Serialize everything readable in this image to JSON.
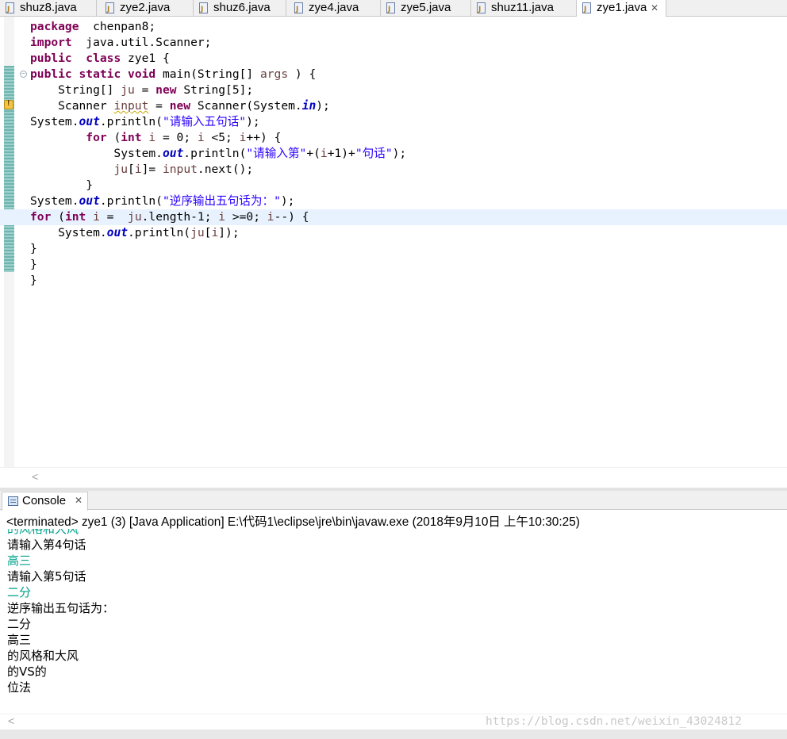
{
  "tabs": [
    {
      "label": "shuz8.java",
      "active": false
    },
    {
      "label": "zye2.java",
      "active": false
    },
    {
      "label": "shuz6.java",
      "active": false
    },
    {
      "label": "zye4.java",
      "active": false
    },
    {
      "label": "zye5.java",
      "active": false
    },
    {
      "label": "shuz11.java",
      "active": false
    },
    {
      "label": "zye1.java",
      "active": true,
      "close": "✕"
    }
  ],
  "code_lines": [
    [
      [
        "kw",
        "package"
      ],
      [
        "",
        "  chenpan8;"
      ]
    ],
    [
      [
        "kw",
        "import"
      ],
      [
        "",
        "  java.util.Scanner;"
      ]
    ],
    [
      [
        "kw",
        "public"
      ],
      [
        "",
        "  "
      ],
      [
        "kw",
        "class"
      ],
      [
        "",
        " zye1 {"
      ]
    ],
    [
      [
        "kw",
        "public"
      ],
      [
        "",
        " "
      ],
      [
        "kw",
        "static"
      ],
      [
        "",
        " "
      ],
      [
        "kw",
        "void"
      ],
      [
        "",
        " main(String[] "
      ],
      [
        "var",
        "args"
      ],
      [
        "",
        " ) {"
      ]
    ],
    [
      [
        "",
        "    String[] "
      ],
      [
        "var",
        "ju"
      ],
      [
        "",
        " = "
      ],
      [
        "kw",
        "new"
      ],
      [
        "",
        " String[5];"
      ]
    ],
    [
      [
        "",
        "    Scanner "
      ],
      [
        "var ul",
        "input"
      ],
      [
        "",
        " = "
      ],
      [
        "kw",
        "new"
      ],
      [
        "",
        " Scanner(System."
      ],
      [
        "fld",
        "in"
      ],
      [
        "",
        ");"
      ]
    ],
    [
      [
        "",
        "System."
      ],
      [
        "fld",
        "out"
      ],
      [
        "",
        ".println("
      ],
      [
        "str",
        "\"请输入五句话\""
      ],
      [
        "",
        ");"
      ]
    ],
    [
      [
        "",
        "        "
      ],
      [
        "kw",
        "for"
      ],
      [
        "",
        " ("
      ],
      [
        "kw",
        "int"
      ],
      [
        "",
        " "
      ],
      [
        "var",
        "i"
      ],
      [
        "",
        " = 0; "
      ],
      [
        "var",
        "i"
      ],
      [
        "",
        " <5; "
      ],
      [
        "var",
        "i"
      ],
      [
        "",
        "++) {"
      ]
    ],
    [
      [
        "",
        "            System."
      ],
      [
        "fld",
        "out"
      ],
      [
        "",
        ".println("
      ],
      [
        "str",
        "\"请输入第\""
      ],
      [
        "",
        "+("
      ],
      [
        "var",
        "i"
      ],
      [
        "",
        "+1)+"
      ],
      [
        "str",
        "\"句话\""
      ],
      [
        "",
        ");"
      ]
    ],
    [
      [
        "",
        "            "
      ],
      [
        "var",
        "ju"
      ],
      [
        "",
        "["
      ],
      [
        "var",
        "i"
      ],
      [
        "",
        "]= "
      ],
      [
        "var",
        "input"
      ],
      [
        "",
        ".next();"
      ]
    ],
    [
      [
        "",
        "        }"
      ]
    ],
    [
      [
        "",
        "System."
      ],
      [
        "fld",
        "out"
      ],
      [
        "",
        ".println("
      ],
      [
        "str",
        "\"逆序输出五句话为：\""
      ],
      [
        "",
        ");"
      ]
    ],
    [
      [
        "kw",
        "for"
      ],
      [
        "",
        " ("
      ],
      [
        "kw",
        "int"
      ],
      [
        "",
        " "
      ],
      [
        "var",
        "i"
      ],
      [
        "",
        " =  "
      ],
      [
        "var",
        "ju"
      ],
      [
        "",
        ".length-1; "
      ],
      [
        "var",
        "i"
      ],
      [
        "",
        " >=0; "
      ],
      [
        "var",
        "i"
      ],
      [
        "",
        "--) {"
      ]
    ],
    [
      [
        "",
        "    System."
      ],
      [
        "fld",
        "out"
      ],
      [
        "",
        ".println("
      ],
      [
        "var",
        "ju"
      ],
      [
        "",
        "["
      ],
      [
        "var",
        "i"
      ],
      [
        "",
        "]);"
      ]
    ],
    [
      [
        "",
        "}"
      ]
    ],
    [
      [
        "",
        "}"
      ]
    ],
    [
      [
        "",
        "}"
      ]
    ]
  ],
  "highlight_line": 12,
  "console": {
    "tab_label": "Console",
    "tab_close": "✕",
    "status_line": "<terminated> zye1 (3) [Java Application] E:\\代码1\\eclipse\\jre\\bin\\javaw.exe (2018年9月10日 上午10:30:25)",
    "output": [
      {
        "text": "的风格和大风",
        "input": true
      },
      {
        "text": "请输入第4句话",
        "input": false
      },
      {
        "text": "高三",
        "input": true
      },
      {
        "text": "请输入第5句话",
        "input": false
      },
      {
        "text": "二分",
        "input": true
      },
      {
        "text": "逆序输出五句话为：",
        "input": false
      },
      {
        "text": "二分",
        "input": false
      },
      {
        "text": "高三",
        "input": false
      },
      {
        "text": "的风格和大风",
        "input": false
      },
      {
        "text": "的VS的",
        "input": false
      },
      {
        "text": "位法",
        "input": false
      }
    ]
  },
  "scroll_arrow_left": "<",
  "watermark": "https://blog.csdn.net/weixin_43024812",
  "colors": {
    "keyword": "#7f0055",
    "field": "#0000c0",
    "string": "#2a00ff",
    "local_var": "#6a3e3e",
    "console_input": "#00a08a",
    "current_line": "#e8f2fe"
  }
}
